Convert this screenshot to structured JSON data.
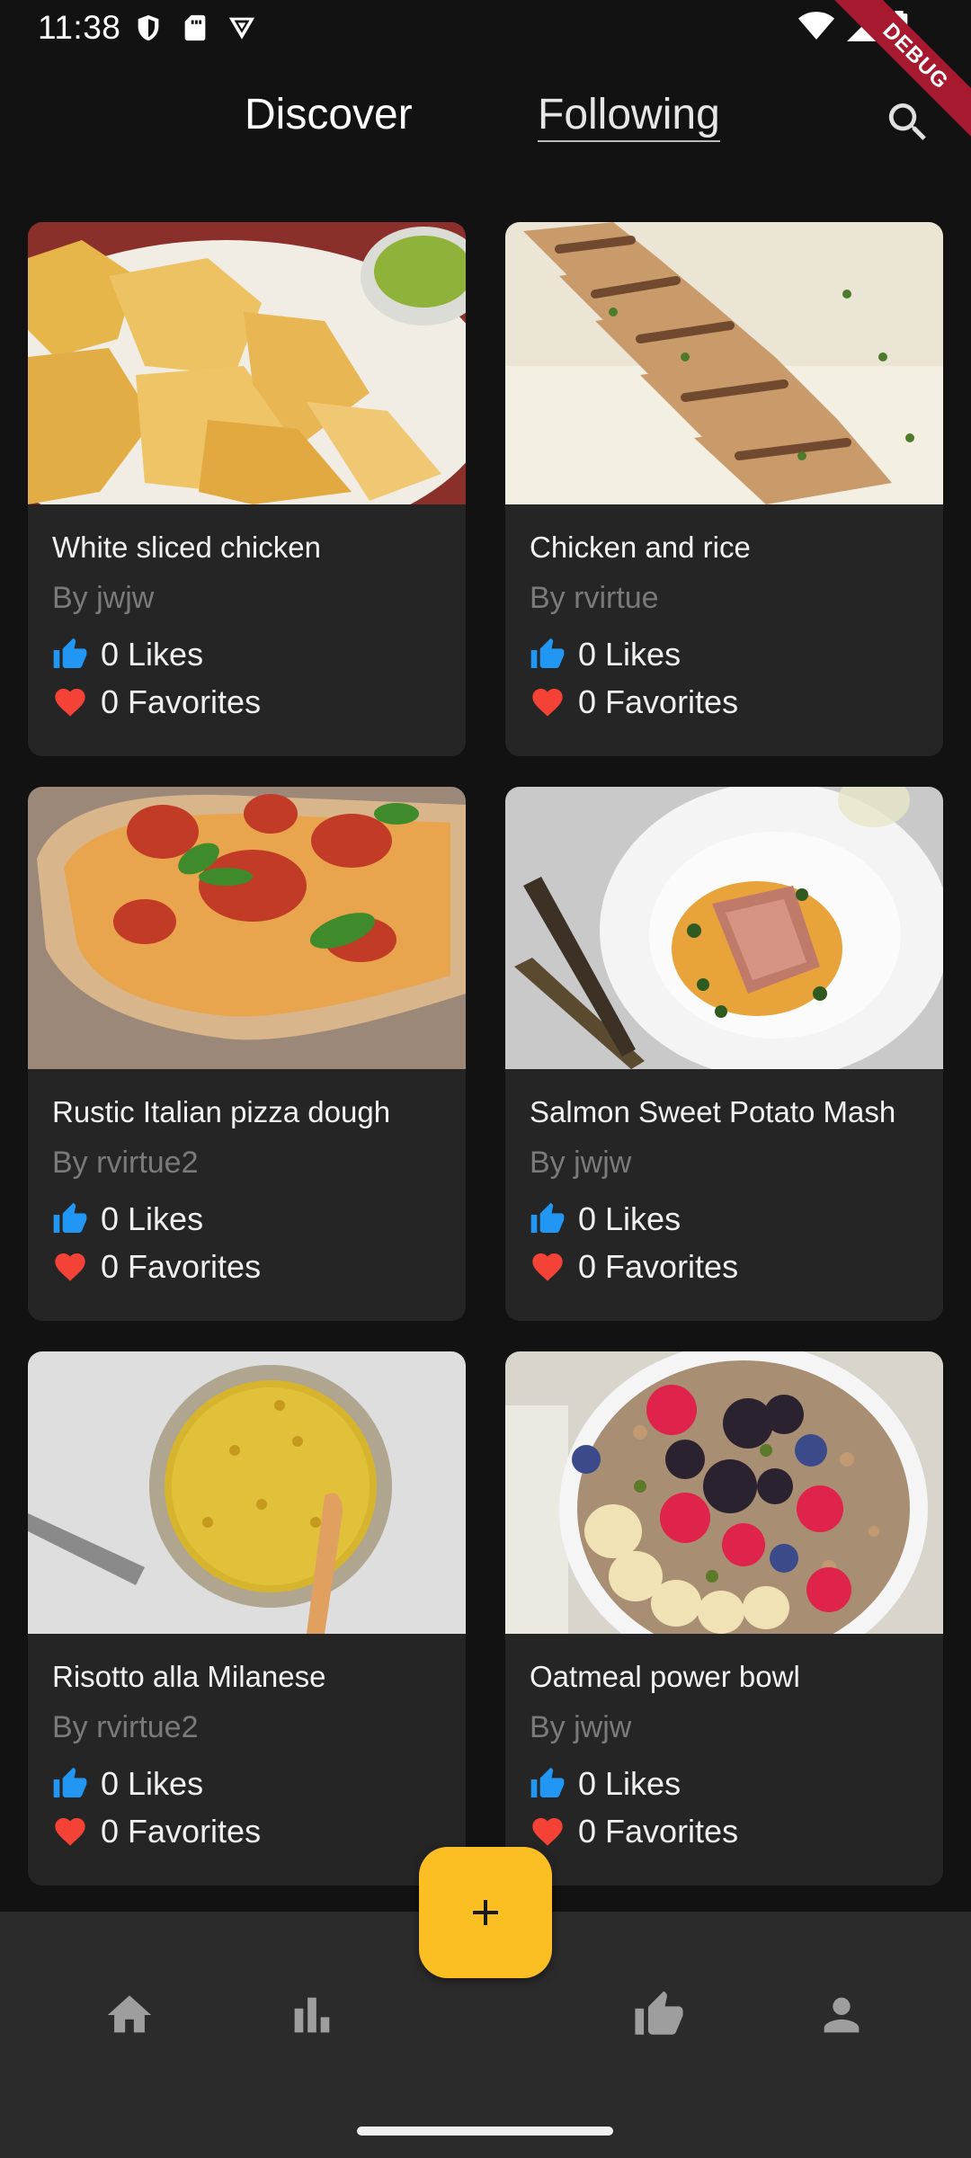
{
  "status_bar": {
    "time": "11:38",
    "left_icons": [
      "shield-icon",
      "sim-card-icon",
      "vpn-icon"
    ],
    "right_icons": [
      "wifi-icon",
      "signal-icon",
      "battery-icon"
    ]
  },
  "debug_ribbon": "DEBUG",
  "header": {
    "tabs": [
      {
        "label": "Discover",
        "active": true
      },
      {
        "label": "Following",
        "active": false
      }
    ],
    "search_icon": "search-icon"
  },
  "recipes": [
    {
      "title": "White sliced chicken",
      "author": "By jwjw",
      "likes": "0",
      "likes_label": "Likes",
      "favorites": "0",
      "favorites_label": "Favorites"
    },
    {
      "title": "Chicken and rice",
      "author": "By rvirtue",
      "likes": "0",
      "likes_label": "Likes",
      "favorites": "0",
      "favorites_label": "Favorites"
    },
    {
      "title": "Rustic Italian pizza dough",
      "author": "By rvirtue2",
      "likes": "0",
      "likes_label": "Likes",
      "favorites": "0",
      "favorites_label": "Favorites"
    },
    {
      "title": "Salmon Sweet Potato Mash",
      "author": "By jwjw",
      "likes": "0",
      "likes_label": "Likes",
      "favorites": "0",
      "favorites_label": "Favorites"
    },
    {
      "title": "Risotto alla Milanese",
      "author": "By rvirtue2",
      "likes": "0",
      "likes_label": "Likes",
      "favorites": "0",
      "favorites_label": "Favorites"
    },
    {
      "title": "Oatmeal power bowl",
      "author": "By jwjw",
      "likes": "0",
      "likes_label": "Likes",
      "favorites": "0",
      "favorites_label": "Favorites"
    }
  ],
  "colors": {
    "background": "#121212",
    "card": "#252525",
    "accent_fab": "#fbbf24",
    "like_blue": "#2196f3",
    "favorite_red": "#f44336",
    "nav_bar": "#2b2b2b"
  },
  "bottom_nav": {
    "items": [
      "home-icon",
      "bar-chart-icon",
      "thumb-up-icon",
      "person-icon"
    ],
    "fab_icon": "plus-icon"
  }
}
